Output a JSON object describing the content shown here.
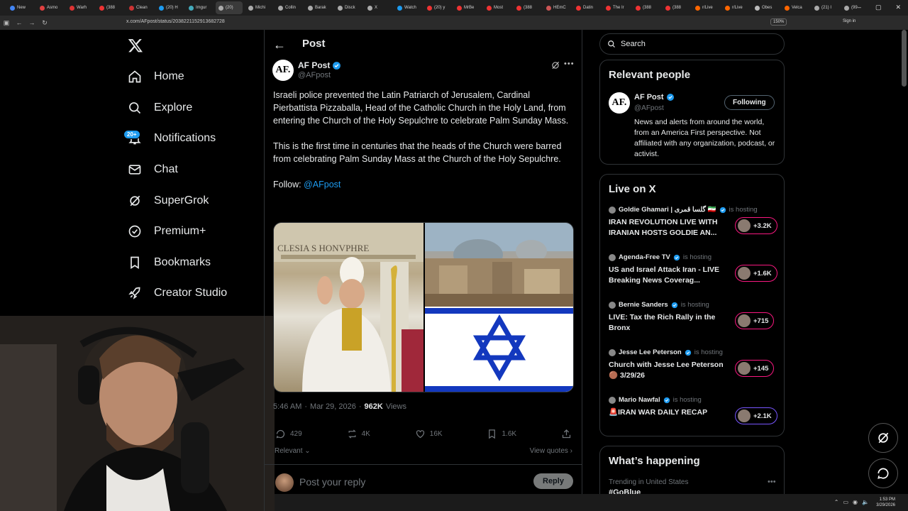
{
  "browser": {
    "tabs": [
      "New",
      "Asmo",
      "Warh",
      "(388",
      "Clean",
      "(20) H",
      "Imgur",
      "(20)",
      "Michi",
      "Collin",
      "Barak",
      "Disck",
      "X",
      "Watch",
      "(20) y",
      "MrBe",
      "Most",
      "(388",
      "HEmC",
      "Datin",
      "The Ir",
      "(388",
      "(388",
      "r/Live",
      "r/Live",
      "Obes",
      "Velca",
      "(21) I",
      "(99"
    ],
    "url": "x.com/AFpost/status/2038221152913682728",
    "zoom": "150%",
    "signin": "Sign in"
  },
  "nav": {
    "home": "Home",
    "explore": "Explore",
    "notifications": "Notifications",
    "notifications_badge": "20+",
    "chat": "Chat",
    "supergrok": "SuperGrok",
    "premium": "Premium+",
    "bookmarks": "Bookmarks",
    "creator_studio": "Creator Studio"
  },
  "post": {
    "header_title": "Post",
    "avatar_text": "AF.",
    "author_name": "AF Post",
    "author_handle": "@AFpost",
    "paragraph1": "Israeli police prevented the Latin Patriarch of Jerusalem, Cardinal Pierbattista Pizzaballa, Head of the Catholic Church in the Holy Land, from entering the Church of the Holy Sepulchre to celebrate Palm Sunday Mass.",
    "paragraph2": "This is the first time in centuries that the heads of the Church were barred from celebrating Palm Sunday Mass at the Church of the Holy Sepulchre.",
    "follow_label": "Follow:",
    "follow_mention": "@AFpost",
    "media_left_caption": "CLESIA S HONVPHRE",
    "time": "5:46 AM",
    "date": "Mar 29, 2026",
    "views_count": "962K",
    "views_label": "Views",
    "replies": "429",
    "reposts": "4K",
    "likes": "16K",
    "bookmarks": "1.6K",
    "relevant_label": "Relevant",
    "view_quotes": "View quotes",
    "reply_placeholder": "Post your reply",
    "reply_button": "Reply"
  },
  "sidebar": {
    "search_placeholder": "Search",
    "relevant_people_title": "Relevant people",
    "rp_avatar_text": "AF.",
    "rp_name": "AF Post",
    "rp_handle": "@AFpost",
    "rp_following": "Following",
    "rp_bio": "News and alerts from around the world, from an America First perspective. Not affiliated with any organization, podcast, or activist.",
    "live_title": "Live on X",
    "live_items": [
      {
        "host": "Goldie Ghamari | گلسا قمری 🇮🇷",
        "hosting": "is hosting",
        "title": "IRAN REVOLUTION LIVE WITH IRANIAN HOSTS GOLDIE AN...",
        "count": "+3.2K"
      },
      {
        "host": "Agenda-Free TV",
        "hosting": "is hosting",
        "title": "US and Israel Attack Iran - LIVE Breaking News Coverag...",
        "count": "+1.6K"
      },
      {
        "host": "Bernie Sanders",
        "hosting": "is hosting",
        "title": "LIVE: Tax the Rich Rally in the Bronx",
        "count": "+715"
      },
      {
        "host": "Jesse Lee Peterson",
        "hosting": "is hosting",
        "title": "Church with Jesse Lee Peterson 🟤 3/29/26",
        "count": "+145"
      },
      {
        "host": "Mario Nawfal",
        "hosting": "is hosting",
        "title": "🚨IRAN WAR DAILY RECAP",
        "count": "+2.1K"
      }
    ],
    "happening_title": "What’s happening",
    "trend_sub": "Trending in United States",
    "trend_name": "#GoBlue"
  },
  "taskbar": {
    "time": "1:53 PM",
    "date": "3/29/2026"
  },
  "colors": {
    "accent": "#1d9bf0",
    "border": "#2f3336",
    "muted": "#71767b",
    "live_pink": "#f91880",
    "live_purple": "#7856ff"
  }
}
